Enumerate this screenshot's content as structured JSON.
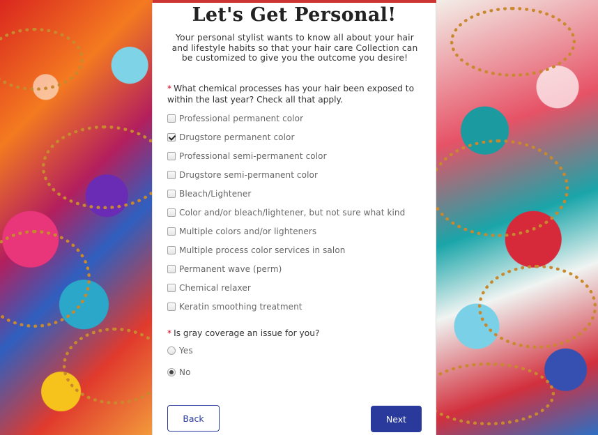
{
  "page": {
    "title": "Let's Get Personal!",
    "subtitle": "Your personal stylist wants to know all about your hair and lifestyle habits so that your hair care Collection can be customized to give you the outcome you desire!"
  },
  "question1": {
    "required_mark": "*",
    "text": "What chemical processes has your hair been exposed to within the last year? Check all that apply.",
    "options": [
      {
        "label": "Professional permanent color",
        "checked": false
      },
      {
        "label": "Drugstore permanent color",
        "checked": true
      },
      {
        "label": "Professional semi-permanent color",
        "checked": false
      },
      {
        "label": "Drugstore semi-permanent color",
        "checked": false
      },
      {
        "label": "Bleach/Lightener",
        "checked": false
      },
      {
        "label": "Color and/or bleach/lightener, but not sure what kind",
        "checked": false
      },
      {
        "label": "Multiple colors and/or lighteners",
        "checked": false
      },
      {
        "label": "Multiple process color services in salon",
        "checked": false
      },
      {
        "label": "Permanent wave (perm)",
        "checked": false
      },
      {
        "label": "Chemical relaxer",
        "checked": false
      },
      {
        "label": "Keratin smoothing treatment",
        "checked": false
      }
    ]
  },
  "question2": {
    "required_mark": "*",
    "text": "Is gray coverage an issue for you?",
    "options": [
      {
        "label": "Yes",
        "selected": false
      },
      {
        "label": "No",
        "selected": true
      }
    ]
  },
  "nav": {
    "back_label": "Back",
    "next_label": "Next"
  },
  "colors": {
    "accent": "#2a3a9c",
    "required": "#d0021b"
  }
}
